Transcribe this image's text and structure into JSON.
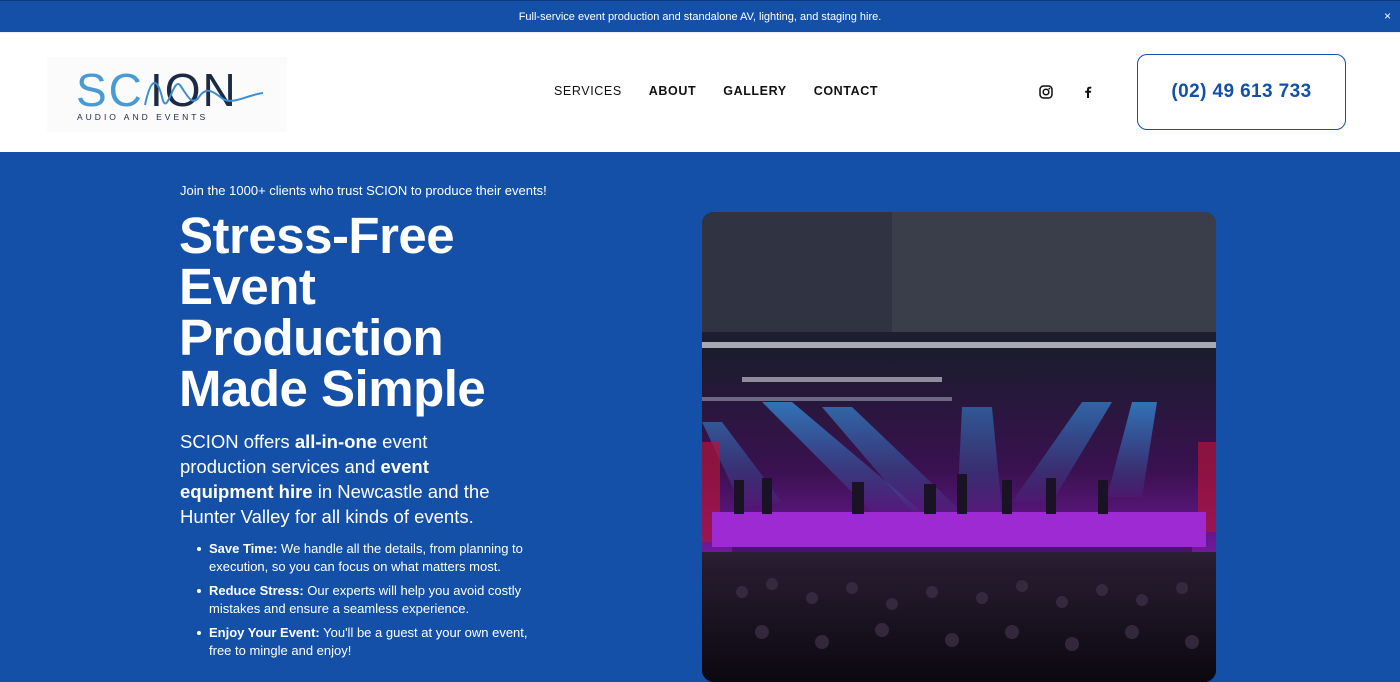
{
  "announcement": {
    "text": "Full-service event production and standalone AV, lighting, and staging hire.",
    "close_icon": "×"
  },
  "header": {
    "logo": {
      "title": "SCION",
      "subtitle": "AUDIO AND EVENTS"
    },
    "nav": [
      {
        "label": "SERVICES"
      },
      {
        "label": "ABOUT"
      },
      {
        "label": "GALLERY"
      },
      {
        "label": "CONTACT"
      }
    ],
    "social": [
      "instagram-icon",
      "facebook-icon"
    ],
    "phone": "(02) 49 613 733"
  },
  "hero": {
    "eyebrow": "Join the 1000+ clients who trust SCION to produce their events!",
    "headline": [
      "Stress-Free",
      "Event",
      "Production",
      "Made Simple"
    ],
    "lede": {
      "p1": "SCION offers ",
      "b1": "all-in-one",
      "p2": " event production services and ",
      "b2": "event equipment hire",
      "p3": " in Newcastle and the Hunter Valley for all kinds of events."
    },
    "benefits": [
      {
        "title": "Save Time:",
        "text": " We handle all the details, from planning to execution, so you can focus on what matters most."
      },
      {
        "title": "Reduce Stress:",
        "text": " Our experts will help you avoid costly mistakes and ensure a seamless experience."
      },
      {
        "title": "Enjoy Your Event:",
        "text": " You'll be a guest at your own event, free to mingle and enjoy!"
      }
    ]
  },
  "colors": {
    "brand_blue": "#1450a8",
    "white": "#ffffff",
    "text_dark": "#111111"
  }
}
